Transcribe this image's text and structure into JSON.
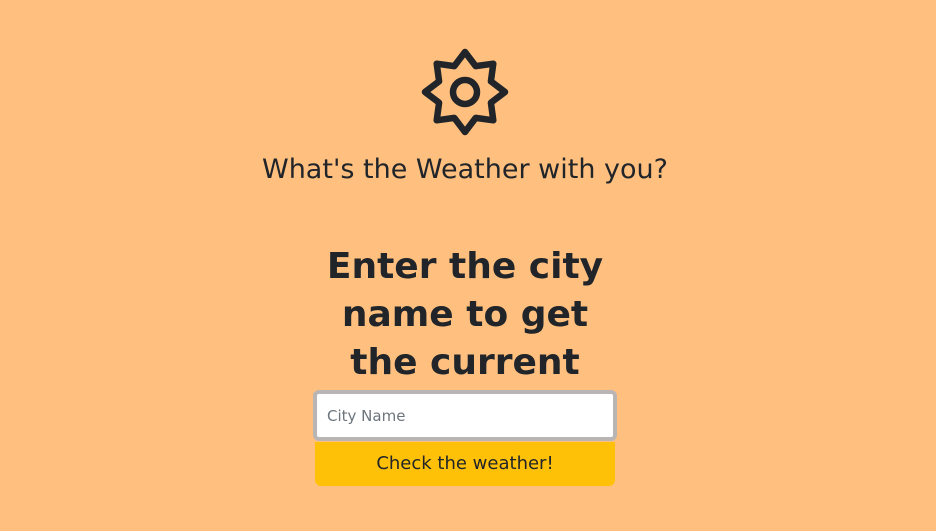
{
  "header": {
    "icon": "sun-icon",
    "title": "What's the Weather with you?"
  },
  "main": {
    "headline": "Enter the city name to get the current weather",
    "city_input": {
      "value": "",
      "placeholder": "City Name"
    },
    "submit_label": "Check the weather!"
  },
  "colors": {
    "background": "#FFC07F",
    "button": "#FFC107",
    "text": "#212529",
    "input_border": "#B9B5B4"
  }
}
